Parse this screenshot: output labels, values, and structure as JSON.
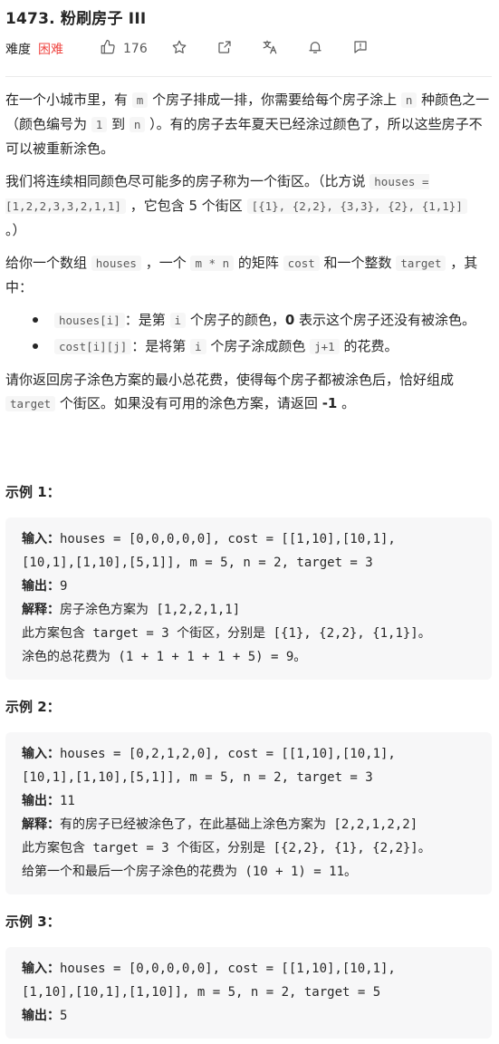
{
  "problem": {
    "title": "1473. 粉刷房子 III",
    "difficulty_label": "难度",
    "difficulty": "困难",
    "likes": "176"
  },
  "icons": {
    "like": "thumbs-up-icon",
    "star": "star-icon",
    "share": "share-icon",
    "translate": "translate-icon",
    "bell": "bell-icon",
    "feedback": "feedback-icon"
  },
  "colors": {
    "difficulty_hard": "#ef4743",
    "code_bg": "#f6f6f6",
    "example_bg": "#f7f7f8"
  },
  "desc": {
    "p1": {
      "a": "在一个小城市里，有 ",
      "c1": "m",
      "b": " 个房子排成一排，你需要给每个房子涂上 ",
      "c2": "n",
      "c": " 种颜色之一（颜色编号为 ",
      "c3": "1",
      "d": " 到 ",
      "c4": "n",
      "e": " ）。有的房子去年夏天已经涂过颜色了，所以这些房子不可以被重新涂色。"
    },
    "p2": {
      "a": "我们将连续相同颜色尽可能多的房子称为一个街区。（比方说 ",
      "c1": "houses = [1,2,2,3,3,2,1,1]",
      "b": " ，它包含 5 个街区  ",
      "c2": "[{1}, {2,2}, {3,3}, {2}, {1,1}]",
      "c": " 。）"
    },
    "p3": {
      "a": "给你一个数组 ",
      "c1": "houses",
      "b": " ，一个 ",
      "c2": "m * n",
      "c": " 的矩阵 ",
      "c3": "cost",
      "d": " 和一个整数 ",
      "c4": "target",
      "e": " ，其中："
    },
    "li1": {
      "c1": "houses[i]",
      "a": "：是第 ",
      "c2": "i",
      "b": " 个房子的颜色，",
      "bold": "0",
      "c": " 表示这个房子还没有被涂色。"
    },
    "li2": {
      "c1": "cost[i][j]",
      "a": "：是将第 ",
      "c2": "i",
      "b": " 个房子涂成颜色 ",
      "c3": "j+1",
      "c": " 的花费。"
    },
    "p4": {
      "a": "请你返回房子涂色方案的最小总花费，使得每个房子都被涂色后，恰好组成 ",
      "c1": "target",
      "b": " 个街区。如果没有可用的涂色方案，请返回 ",
      "bold": "-1",
      "c": " 。"
    }
  },
  "examples": [
    {
      "title": "示例 1：",
      "input_label": "输入：",
      "input_l1": "houses = [0,0,0,0,0], cost = [[1,10],[10,1],",
      "input_l2": "[10,1],[1,10],[5,1]], m = 5, n = 2, target = 3",
      "output_label": "输出：",
      "output": "9",
      "explain_label": "解释：",
      "explain_l1_zh": "房子涂色方案为",
      "explain_l1_code": " [1,2,2,1,1]",
      "explain_l2_zh1": "此方案包含",
      "explain_l2_code": " target = 3 ",
      "explain_l2_zh2": "个街区，分别是",
      "explain_l2_code2": " [{1}, {2,2}, {1,1}]。",
      "explain_l3_zh": "涂色的总花费为",
      "explain_l3_code": " (1 + 1 + 1 + 1 + 5) = 9。"
    },
    {
      "title": "示例 2：",
      "input_label": "输入：",
      "input_l1": "houses = [0,2,1,2,0], cost = [[1,10],[10,1],",
      "input_l2": "[10,1],[1,10],[5,1]], m = 5, n = 2, target = 3",
      "output_label": "输出：",
      "output": "11",
      "explain_label": "解释：",
      "explain_l1_zh": "有的房子已经被涂色了，在此基础上涂色方案为",
      "explain_l1_code": " [2,2,1,2,2]",
      "explain_l2_zh1": "此方案包含",
      "explain_l2_code": " target = 3 ",
      "explain_l2_zh2": "个街区，分别是",
      "explain_l2_code2": " [{2,2}, {1}, {2,2}]。",
      "explain_l3_zh": "给第一个和最后一个房子涂色的花费为",
      "explain_l3_code": " (10 + 1) = 11。"
    },
    {
      "title": "示例 3：",
      "input_label": "输入：",
      "input_l1": "houses = [0,0,0,0,0], cost = [[1,10],[10,1],",
      "input_l2": "[1,10],[10,1],[1,10]], m = 5, n = 2, target = 5",
      "output_label": "输出：",
      "output": "5"
    }
  ]
}
